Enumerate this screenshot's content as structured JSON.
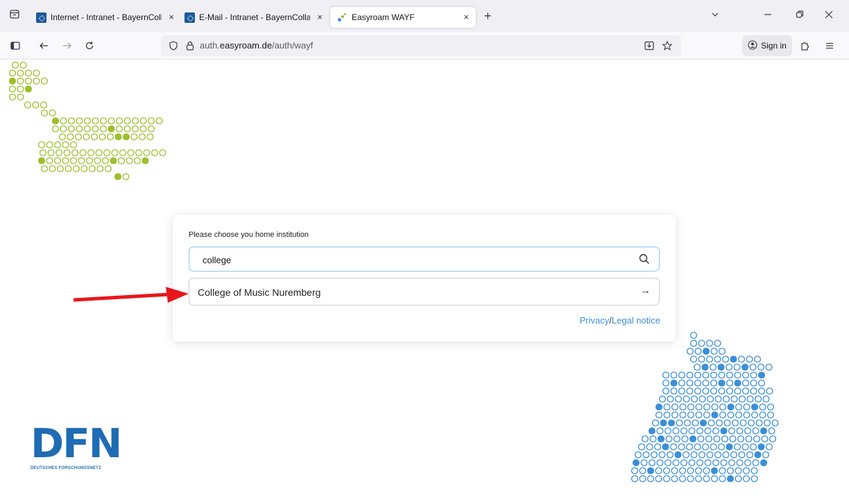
{
  "browser": {
    "tabs": [
      {
        "title": "Internet - Intranet - BayernCollab",
        "active": false
      },
      {
        "title": "E-Mail - Intranet - BayernCollab",
        "active": false
      },
      {
        "title": "Easyroam WAYF",
        "active": true
      }
    ],
    "url_prefix": "auth.",
    "url_domain": "easyroam.de",
    "url_path": "/auth/wayf",
    "sign_in_label": "Sign in",
    "new_tab_symbol": "+",
    "close_symbol": "×"
  },
  "wayf": {
    "prompt": "Please choose you home institution",
    "search_value": "college",
    "result_label": "College of Music Nuremberg",
    "result_arrow": "→",
    "privacy_label": "Privacy",
    "separator": "/",
    "legal_label": "Legal notice"
  },
  "logo": {
    "letters": "DFN",
    "subtitle": "DEUTSCHES FORSCHUNGSNETZ"
  },
  "colors": {
    "accent_green": "#9cbf2b",
    "accent_blue": "#3b8fd6",
    "dfn_blue": "#1f6cb4",
    "annotation_red": "#e8171c"
  }
}
